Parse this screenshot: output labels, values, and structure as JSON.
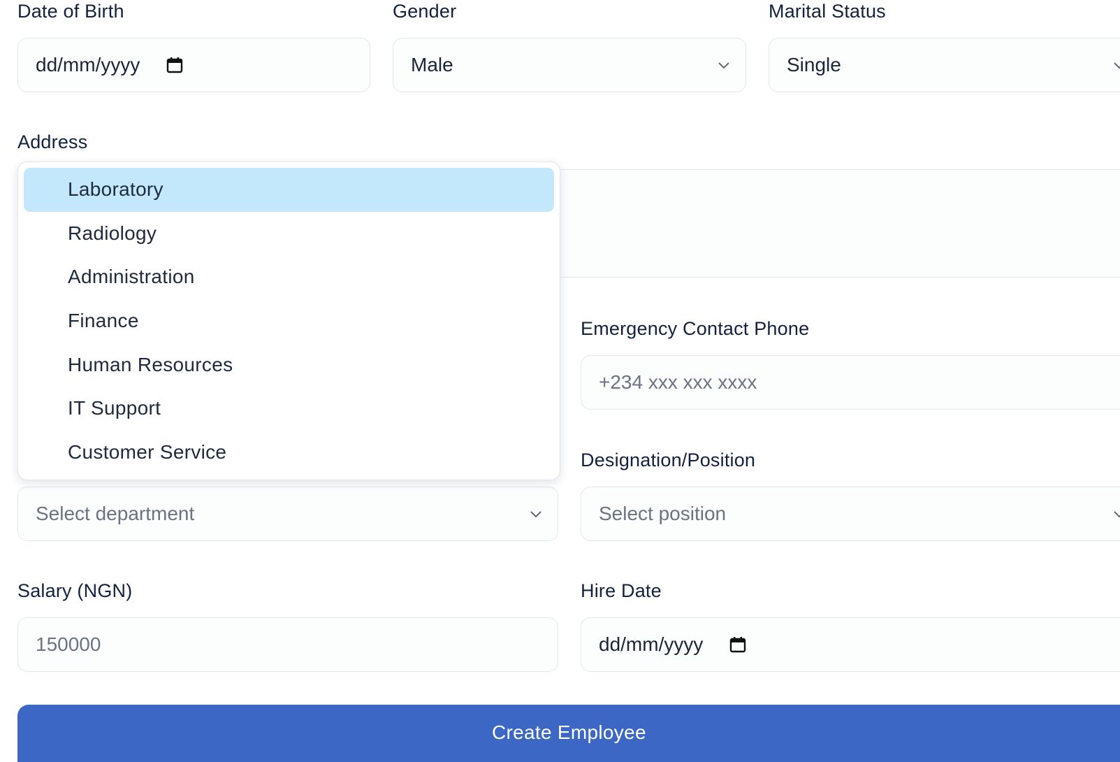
{
  "form": {
    "dob": {
      "label": "Date of Birth",
      "value": "dd/mm/yyyy",
      "icon": "calendar-icon"
    },
    "gender": {
      "label": "Gender",
      "value": "Male",
      "icon": "chevron-down-icon"
    },
    "marital_status": {
      "label": "Marital Status",
      "value": "Single",
      "icon": "chevron-down-icon"
    },
    "address": {
      "label": "Address",
      "value": ""
    },
    "emergency_contact_phone": {
      "label": "Emergency Contact Phone",
      "placeholder": "+234 xxx xxx xxxx"
    },
    "department": {
      "placeholder": "Select department",
      "options": [
        "Laboratory",
        "Radiology",
        "Administration",
        "Finance",
        "Human Resources",
        "IT Support",
        "Customer Service"
      ],
      "highlighted_option": "Laboratory"
    },
    "designation": {
      "label": "Designation/Position",
      "placeholder": "Select position"
    },
    "salary": {
      "label": "Salary (NGN)",
      "placeholder": "150000"
    },
    "hire_date": {
      "label": "Hire Date",
      "value": "dd/mm/yyyy",
      "icon": "calendar-icon"
    },
    "submit_label": "Create Employee"
  },
  "colors": {
    "primary_button": "#3c67c5",
    "highlight": "#c3e7fb",
    "label_text": "#13213f",
    "border": "#e2e6ec"
  }
}
